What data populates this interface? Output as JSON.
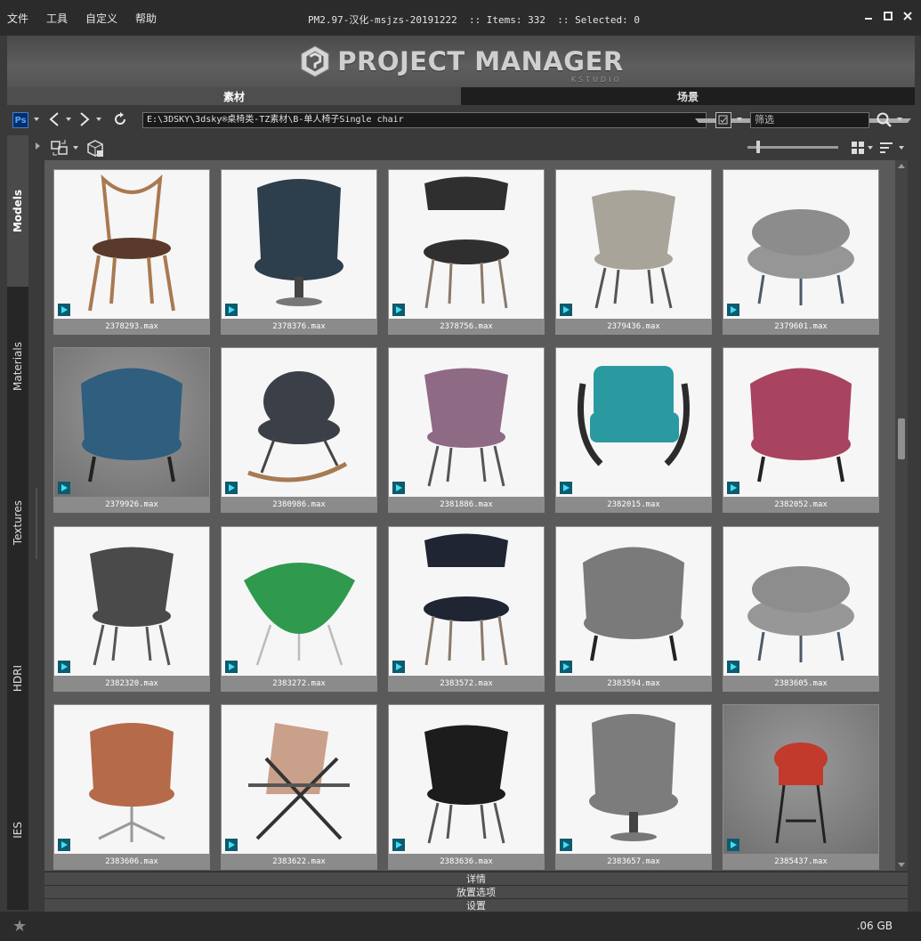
{
  "menu": [
    "文件",
    "工具",
    "自定义",
    "帮助"
  ],
  "window_title": "PM2.97-汉化-msjzs-20191222  :: Items: 332  :: Selected: 0",
  "banner": {
    "title": "PROJECT MANAGER",
    "subtitle": "KSTUDIO"
  },
  "tabs": [
    {
      "label": "素材",
      "active": true
    },
    {
      "label": "场景",
      "active": false
    }
  ],
  "toolbar": {
    "ps_label": "Ps",
    "path": "E:\\3DSKY\\3dsky®桌椅类-TZ素材\\B-单人椅子Single chair",
    "search_placeholder": "筛选"
  },
  "side_tabs": [
    {
      "label": "Models",
      "active": true
    },
    {
      "label": "Materials",
      "active": false
    },
    {
      "label": "Textures",
      "active": false
    },
    {
      "label": "HDRI",
      "active": false
    },
    {
      "label": "IES",
      "active": false
    }
  ],
  "items": [
    {
      "file": "2378293.max",
      "style": "wood",
      "color": "#5a3a2a"
    },
    {
      "file": "2378376.max",
      "style": "wingback",
      "color": "#2d3e4c"
    },
    {
      "file": "2378756.max",
      "style": "dining",
      "color": "#2f2f2f"
    },
    {
      "file": "2379436.max",
      "style": "shell",
      "color": "#a8a49a"
    },
    {
      "file": "2379601.max",
      "style": "tub",
      "color": "#8c8c8c"
    },
    {
      "file": "2379926.max",
      "style": "lounge",
      "color": "#2f5e7f"
    },
    {
      "file": "2380986.max",
      "style": "rocker",
      "color": "#3b4048"
    },
    {
      "file": "2381886.max",
      "style": "shell",
      "color": "#8f6a84"
    },
    {
      "file": "2382015.max",
      "style": "cantilever",
      "color": "#2a9aa0"
    },
    {
      "file": "2382052.max",
      "style": "lounge",
      "color": "#a8445f"
    },
    {
      "file": "2382320.max",
      "style": "shell",
      "color": "#4a4a4a"
    },
    {
      "file": "2383272.max",
      "style": "bowl",
      "color": "#2f9a4e"
    },
    {
      "file": "2383572.max",
      "style": "dining",
      "color": "#1f2533"
    },
    {
      "file": "2383594.max",
      "style": "lounge",
      "color": "#7a7a7a"
    },
    {
      "file": "2383605.max",
      "style": "tub",
      "color": "#8d8d8d"
    },
    {
      "file": "2383606.max",
      "style": "swivel",
      "color": "#b56b4a"
    },
    {
      "file": "2383622.max",
      "style": "sling",
      "color": "#c9a08a"
    },
    {
      "file": "2383636.max",
      "style": "shell",
      "color": "#1c1c1c"
    },
    {
      "file": "2383657.max",
      "style": "wingback",
      "color": "#7c7c7c"
    },
    {
      "file": "2385437.max",
      "style": "stool",
      "color": "#c23a2c"
    }
  ],
  "panels": [
    "详情",
    "放置选项",
    "设置"
  ],
  "status": {
    "disk": ".06 GB"
  }
}
